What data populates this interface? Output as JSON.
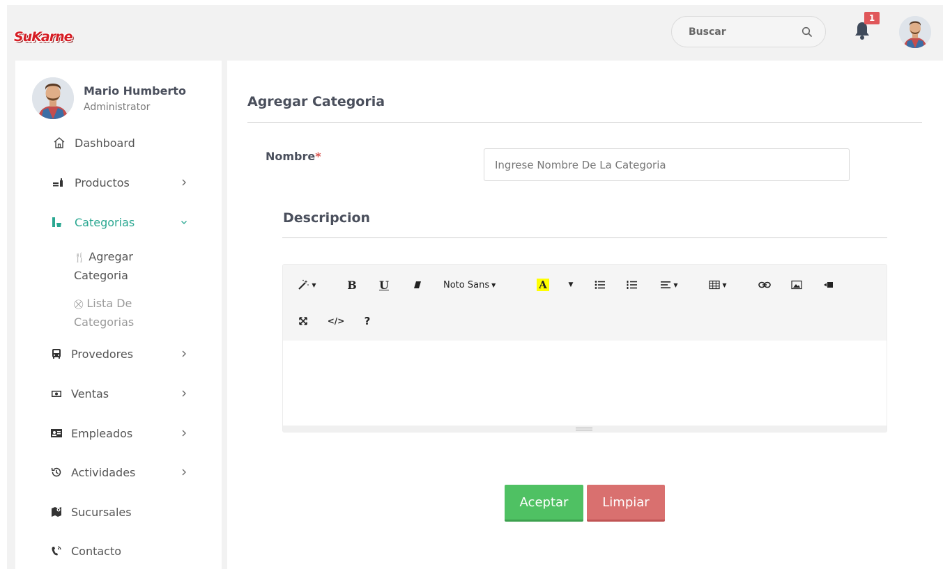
{
  "header": {
    "logo_text": "SuKarne",
    "search_placeholder": "Buscar",
    "notification_count": "1"
  },
  "user": {
    "name": "Mario Humberto",
    "role": "Administrator"
  },
  "sidebar": {
    "items": [
      {
        "label": "Dashboard",
        "icon": "home-icon"
      },
      {
        "label": "Productos",
        "icon": "products-icon",
        "has_submenu": true
      },
      {
        "label": "Categorias",
        "icon": "categories-icon",
        "has_submenu": true,
        "expanded": true,
        "active": true
      },
      {
        "label": "Provedores",
        "icon": "bus-icon",
        "has_submenu": true
      },
      {
        "label": "Ventas",
        "icon": "money-icon",
        "has_submenu": true
      },
      {
        "label": "Empleados",
        "icon": "id-card-icon",
        "has_submenu": true
      },
      {
        "label": "Actividades",
        "icon": "history-icon",
        "has_submenu": true
      },
      {
        "label": "Sucursales",
        "icon": "map-icon"
      },
      {
        "label": "Contacto",
        "icon": "phone-icon"
      }
    ],
    "subitems": [
      {
        "icon": "🍴",
        "label_line1": "Agregar",
        "label_line2": "Categoria"
      },
      {
        "icon": "⛒",
        "label_line1": "Lista De",
        "label_line2": "Categorias"
      }
    ]
  },
  "main": {
    "title": "Agregar Categoria",
    "name_label": "Nombre",
    "required_mark": "*",
    "name_placeholder": "Ingrese Nombre De La Categoria",
    "description_title": "Descripcion",
    "editor": {
      "font_name": "Noto Sans",
      "bold": "B",
      "underline": "U",
      "code": "</>",
      "help": "?",
      "highlight": "A"
    },
    "accept_label": "Aceptar",
    "clear_label": "Limpiar"
  },
  "colors": {
    "accent": "#2aa791",
    "brand_red": "#d61d24",
    "accept": "#4fc163",
    "clear": "#d9706f",
    "badge": "#e0575a"
  }
}
